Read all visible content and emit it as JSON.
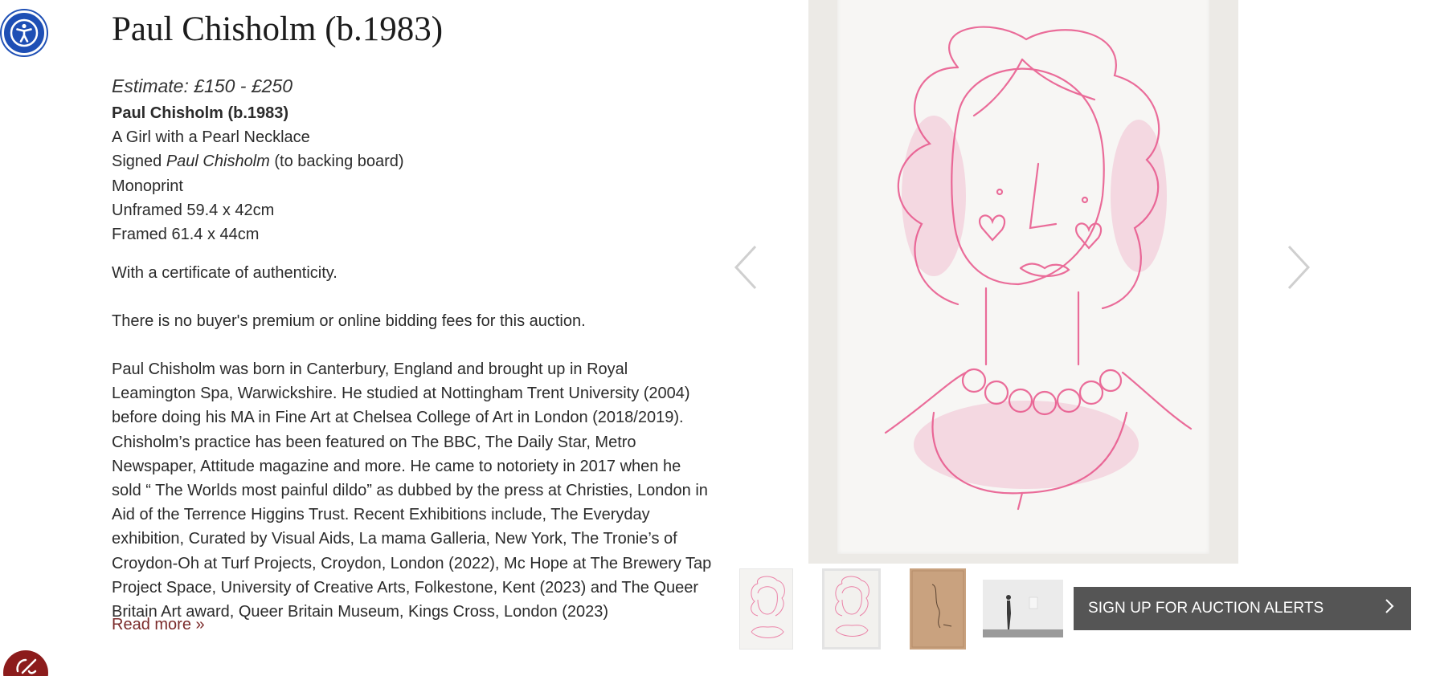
{
  "lot": {
    "title": "Paul Chisholm (b.1983)",
    "estimate": "Estimate: £150 - £250",
    "artist": "Paul Chisholm (b.1983)",
    "work_title": "A Girl with a Pearl Necklace",
    "signed_prefix": "Signed ",
    "signed_name": "Paul Chisholm",
    "signed_suffix": " (to backing board)",
    "medium": "Monoprint",
    "unframed": "Unframed 59.4 x 42cm",
    "framed": "Framed 61.4 x 44cm",
    "certificate": "With a certificate of authenticity.",
    "premium_note": "There is no buyer's premium or online bidding fees for this auction.",
    "bio": "Paul Chisholm was born in Canterbury, England and brought up in Royal Leamington Spa, Warwickshire. He studied at Nottingham Trent University (2004) before doing his MA in Fine Art at Chelsea College of Art in London (2018/2019). Chisholm’s practice has been featured on The BBC, The Daily Star, Metro Newspaper, Attitude magazine and more. He came to notoriety in 2017 when he sold “ The Worlds most painful dildo” as dubbed by the press at Christies, London in Aid of the Terrence Higgins Trust. Recent Exhibitions include, The Everyday exhibition, Curated by Visual Aids, La mama Galleria, New York, The Tronie’s of Croydon-Oh at Turf Projects, Croydon, London (2022), Mc Hope at The Brewery Tap Project Space, University of Creative Arts, Folkestone, Kent (2023) and The Queer Britain Art award, Queer Britain Museum, Kings Cross, London (2023)",
    "read_more": "Read more »"
  },
  "gallery": {
    "prev_icon": "chevron-left-icon",
    "next_icon": "chevron-right-icon",
    "thumbnails": [
      "drawing-front",
      "drawing-framed",
      "backing-board-signature",
      "installation-view"
    ]
  },
  "alerts": {
    "label": "SIGN UP FOR AUCTION ALERTS",
    "icon": "chevron-right-icon"
  },
  "colors": {
    "accessibility": "#1e4fb5",
    "feedback": "#8c1c1c",
    "link": "#7a2a2a",
    "alerts_bg": "#555555",
    "drawing_pink": "#e8548a"
  }
}
